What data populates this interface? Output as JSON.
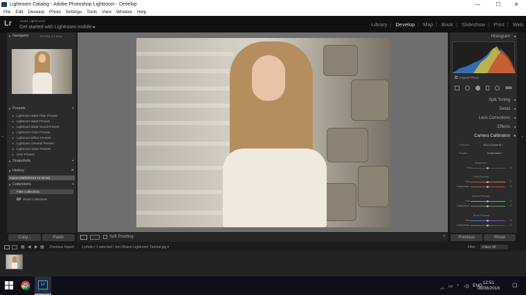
{
  "window": {
    "title": "Lightroom Catalog - Adobe Photoshop Lightroom - Develop",
    "buttons": [
      "—",
      "☐",
      "✕"
    ]
  },
  "menu": [
    "File",
    "Edit",
    "Develop",
    "Photo",
    "Settings",
    "Tools",
    "View",
    "Window",
    "Help"
  ],
  "identity": {
    "logo": "Lr",
    "line1": "Adobe Lightroom®",
    "line2": "Get started with Lightroom mobile ▸"
  },
  "modules": [
    "Library",
    "Develop",
    "Map",
    "Book",
    "Slideshow",
    "Print",
    "Web"
  ],
  "left": {
    "navigator": {
      "title": "Navigator",
      "zoom": [
        "FIT",
        "FILL",
        "1:1",
        "3:1 ▾"
      ]
    },
    "presets": {
      "title": "Presets",
      "items": [
        "Lightroom B&W Filter Presets",
        "Lightroom B&W Presets",
        "Lightroom B&W Toned Presets",
        "Lightroom Color Presets",
        "Lightroom Effect Presets",
        "Lightroom General Presets",
        "Lightroom Video Presets",
        "User Presets"
      ]
    },
    "snapshots": {
      "title": "Snapshots"
    },
    "history": {
      "title": "History",
      "item": "Import (08/08/2018 12:40:48)"
    },
    "collections": {
      "title": "Collections",
      "items": [
        "Filter Collections",
        "Smart Collections"
      ]
    },
    "copy": "Copy...",
    "paste": "Paste"
  },
  "toolbar": {
    "soft_proofing": "Soft Proofing"
  },
  "right": {
    "histogram": "Histogram",
    "original_photo": "Original Photo",
    "panels": [
      "Split Toning",
      "Detail",
      "Lens Corrections",
      "Effects"
    ],
    "calibration": {
      "title": "Camera Calibration",
      "process_label": "Process",
      "process_value": "2012 (Current) ÷",
      "profile_label": "Profile",
      "profile_value": "Embedded ÷",
      "shadows": "Shadows",
      "tint": "Tint",
      "red": "Red Primary",
      "green": "Green Primary",
      "blue": "Blue Primary",
      "hue": "Hue",
      "saturation": "Saturation",
      "zero": "0"
    },
    "previous": "Previous",
    "reset": "Reset"
  },
  "bottom": {
    "source": "Previous Import",
    "info": "1 photo / 1 selected / Jon Olsson Lightroom Tutorial.jpg ▾",
    "filter_label": "Filter :",
    "filter_value": "Filters Off"
  },
  "taskbar": {
    "lang": "ENG",
    "time": "12:51",
    "date": "08/08/2018"
  }
}
